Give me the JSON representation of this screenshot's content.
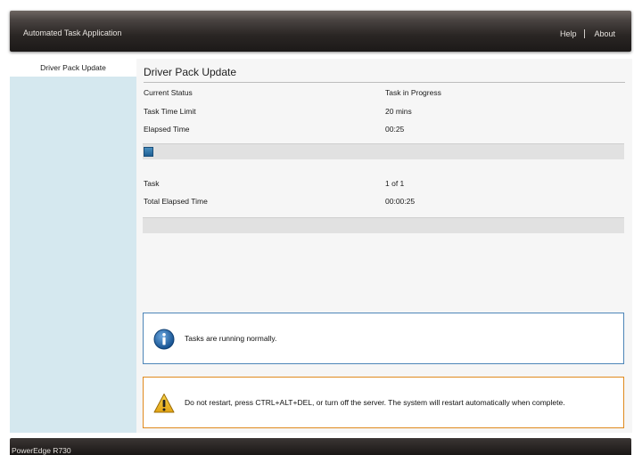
{
  "header": {
    "app_title": "Automated Task Application",
    "nav": {
      "help": "Help",
      "about": "About"
    }
  },
  "sidebar": {
    "items": [
      {
        "label": "Driver Pack Update"
      }
    ]
  },
  "main": {
    "title": "Driver Pack Update",
    "status_rows": [
      {
        "label": "Current Status",
        "value": "Task in Progress"
      },
      {
        "label": "Task Time Limit",
        "value": "20 mins"
      },
      {
        "label": "Elapsed Time",
        "value": "00:25"
      }
    ],
    "task_progress_fraction": 0.02,
    "summary_rows": [
      {
        "label": "Task",
        "value": "1 of 1"
      },
      {
        "label": "Total Elapsed Time",
        "value": "00:00:25"
      }
    ],
    "overall_progress_fraction": 0.0,
    "info_message": "Tasks are running normally.",
    "warning_message": "Do not restart, press CTRL+ALT+DEL, or turn off the server.  The system will restart automatically when complete."
  },
  "footer": {
    "model": "PowerEdge R730"
  },
  "colors": {
    "info_border": "#4d85b8",
    "warning_border": "#e08a1e",
    "sidebar_bg": "#d5e8ef",
    "progress_fill": "#1f5f94"
  },
  "icons": {
    "info": "info-icon",
    "warning": "warning-icon"
  }
}
